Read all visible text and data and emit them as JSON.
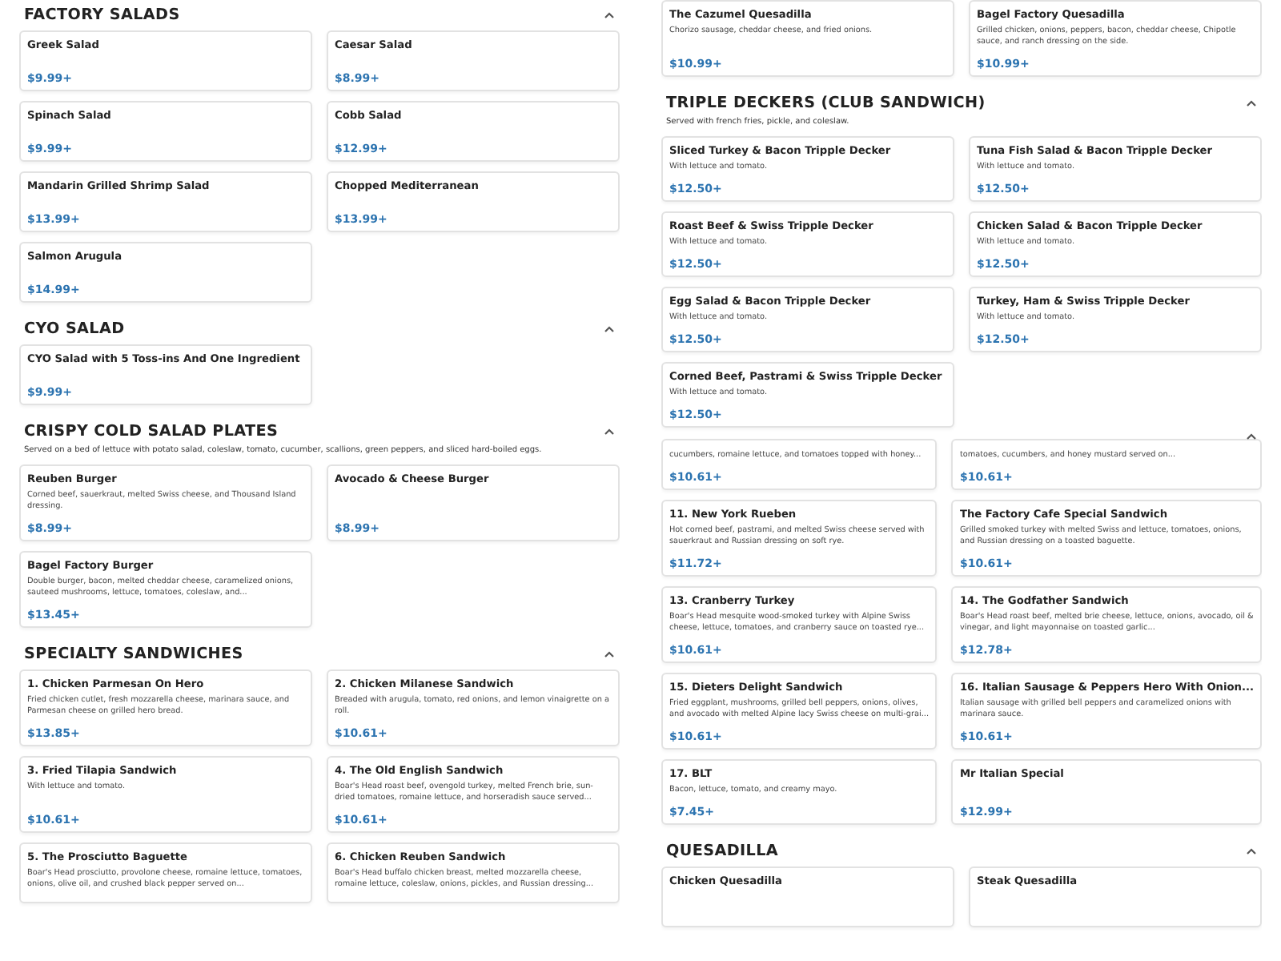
{
  "columns": [
    {
      "sections": [
        {
          "title": "FACTORY SALADS",
          "expanded": true,
          "items": [
            {
              "name": "Greek Salad",
              "price": "$9.99+"
            },
            {
              "name": "Caesar Salad",
              "price": "$8.99+"
            },
            {
              "name": "Spinach Salad",
              "price": "$9.99+"
            },
            {
              "name": "Cobb Salad",
              "price": "$12.99+"
            },
            {
              "name": "Mandarin Grilled Shrimp Salad",
              "price": "$13.99+"
            },
            {
              "name": "Chopped Mediterranean",
              "price": "$13.99+"
            },
            {
              "name": "Salmon Arugula",
              "price": "$14.99+"
            }
          ]
        },
        {
          "title": "CYO SALAD",
          "expanded": true,
          "items": [
            {
              "name": "CYO Salad with 5 Toss-ins And One Ingredient",
              "price": "$9.99+"
            }
          ]
        },
        {
          "title": "CRISPY COLD SALAD PLATES",
          "expanded": true,
          "note": "Served on a bed of lettuce with potato salad, coleslaw, tomato, cucumber, scallions, green peppers, and sliced hard-boiled eggs.",
          "items": [
            {
              "name": "Reuben Burger",
              "description": "Corned beef, sauerkraut, melted Swiss cheese, and Thousand Island dressing.",
              "price": "$8.99+"
            },
            {
              "name": "Avocado & Cheese Burger",
              "price": "$8.99+"
            },
            {
              "name": "Bagel Factory Burger",
              "description": "Double burger, bacon, melted cheddar cheese, caramelized onions, sauteed mushrooms, lettuce, tomatoes, coleslaw, and...",
              "price": "$13.45+"
            }
          ]
        },
        {
          "title": "SPECIALTY SANDWICHES",
          "expanded": true,
          "items": [
            {
              "name": "1. Chicken Parmesan On Hero",
              "description": "Fried chicken cutlet, fresh mozzarella cheese, marinara sauce, and Parmesan cheese on grilled hero bread.",
              "price": "$13.85+"
            },
            {
              "name": "2. Chicken Milanese Sandwich",
              "description": "Breaded with arugula, tomato, red onions, and lemon vinaigrette on a roll.",
              "price": "$10.61+"
            },
            {
              "name": "3. Fried Tilapia Sandwich",
              "description": "With lettuce and tomato.",
              "price": "$10.61+"
            },
            {
              "name": "4. The Old English Sandwich",
              "description": "Boar's Head roast beef, ovengold turkey, melted French brie, sun-dried tomatoes, romaine lettuce, and horseradish sauce served...",
              "price": "$10.61+"
            },
            {
              "name": "5. The Prosciutto Baguette",
              "description": "Boar's Head prosciutto, provolone cheese, romaine lettuce, tomatoes, onions, olive oil, and crushed black pepper served on..."
            },
            {
              "name": "6. Chicken Reuben Sandwich",
              "description": "Boar's Head buffalo chicken breast, melted mozzarella cheese, romaine lettuce, coleslaw, onions, pickles, and Russian dressing..."
            }
          ]
        }
      ]
    },
    {
      "sections": [
        {
          "items": [
            {
              "name": "The Cazumel Quesadilla",
              "description": "Chorizo sausage, cheddar cheese, and fried onions.",
              "price": "$10.99+"
            },
            {
              "name": "Bagel Factory Quesadilla",
              "description": "Grilled chicken, onions, peppers, bacon, cheddar cheese, Chipotle sauce, and ranch dressing on the side.",
              "price": "$10.99+"
            }
          ]
        },
        {
          "title": "TRIPLE DECKERS (CLUB SANDWICH)",
          "expanded": true,
          "note": "Served with french fries, pickle, and coleslaw.",
          "items": [
            {
              "name": "Sliced Turkey & Bacon Tripple Decker",
              "description": "With lettuce and tomato.",
              "price": "$12.50+"
            },
            {
              "name": "Tuna Fish Salad & Bacon Tripple Decker",
              "description": "With lettuce and tomato.",
              "price": "$12.50+"
            },
            {
              "name": "Roast Beef & Swiss Tripple Decker",
              "description": "With lettuce and tomato.",
              "price": "$12.50+"
            },
            {
              "name": "Chicken Salad & Bacon Tripple Decker",
              "description": "With lettuce and tomato.",
              "price": "$12.50+"
            },
            {
              "name": "Egg Salad & Bacon Tripple Decker",
              "description": "With lettuce and tomato.",
              "price": "$12.50+"
            },
            {
              "name": "Turkey, Ham & Swiss Tripple Decker",
              "description": "With lettuce and tomato.",
              "price": "$12.50+"
            },
            {
              "name": "Corned Beef, Pastrami & Swiss Tripple Decker",
              "description": "With lettuce and tomato.",
              "price": "$12.50+"
            }
          ]
        },
        {
          "expanded": true,
          "items": [
            {
              "description": "cucumbers, romaine lettuce, and tomatoes topped with honey...",
              "price": "$10.61+"
            },
            {
              "description": "tomatoes, cucumbers, and honey mustard served on...",
              "price": "$10.61+"
            },
            {
              "name": "11. New York Rueben",
              "description": "Hot corned beef, pastrami, and melted Swiss cheese served with sauerkraut and Russian dressing on soft rye.",
              "price": "$11.72+"
            },
            {
              "name": "The Factory Cafe Special Sandwich",
              "description": "Grilled smoked turkey with melted Swiss and lettuce, tomatoes, onions, and Russian dressing on a toasted baguette.",
              "price": "$10.61+"
            },
            {
              "name": "13. Cranberry Turkey",
              "description": "Boar's Head mesquite wood-smoked turkey with Alpine Swiss cheese, lettuce, tomatoes, and cranberry sauce on toasted rye...",
              "price": "$10.61+"
            },
            {
              "name": "14. The Godfather Sandwich",
              "description": "Boar's Head roast beef, melted brie cheese, lettuce, onions, avocado, oil & vinegar, and light mayonnaise on toasted garlic...",
              "price": "$12.78+"
            },
            {
              "name": "15. Dieters Delight Sandwich",
              "description": "Fried eggplant, mushrooms, grilled bell peppers, onions, olives, and avocado with melted Alpine lacy Swiss cheese on multi-grai...",
              "price": "$10.61+"
            },
            {
              "name": "16. Italian Sausage & Peppers Hero With Onion...",
              "description": "Italian sausage with grilled bell peppers and caramelized onions with marinara sauce.",
              "price": "$10.61+"
            },
            {
              "name": "17. BLT",
              "description": "Bacon, lettuce, tomato, and creamy mayo.",
              "price": "$7.45+"
            },
            {
              "name": "Mr Italian Special",
              "price": "$12.99+"
            }
          ]
        },
        {
          "title": "QUESADILLA",
          "expanded": true,
          "items": [
            {
              "name": "Chicken Quesadilla"
            },
            {
              "name": "Steak Quesadilla"
            }
          ]
        }
      ]
    }
  ]
}
